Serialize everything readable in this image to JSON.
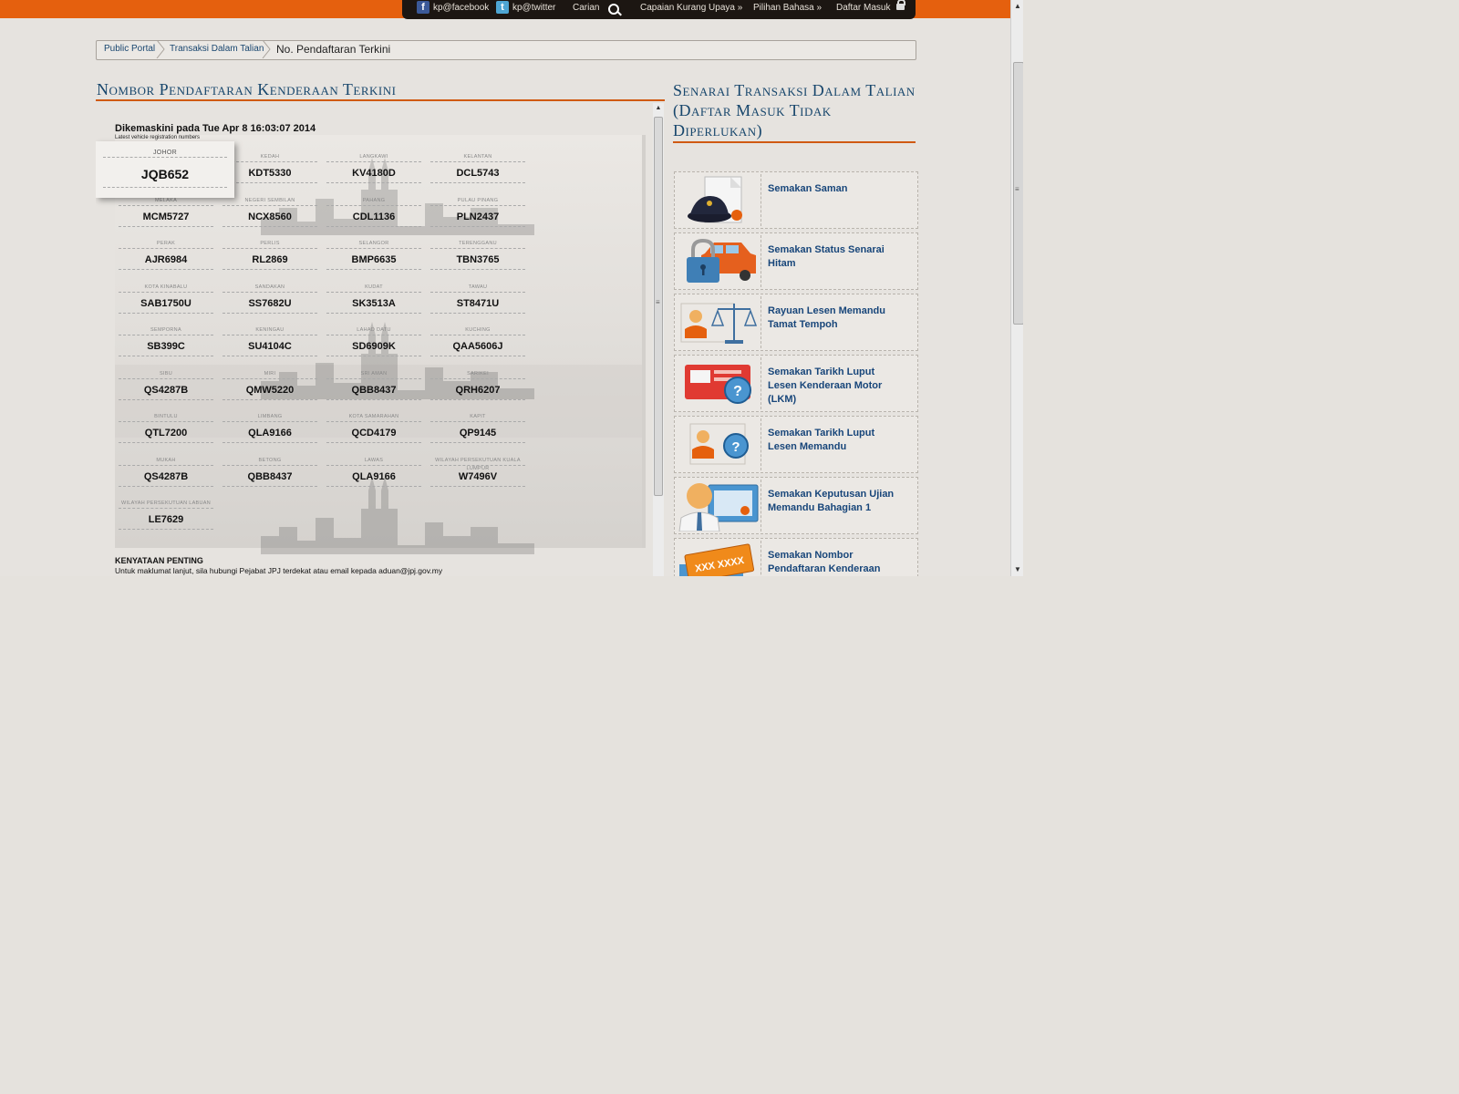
{
  "topnav": {
    "facebook": "kp@facebook",
    "twitter": "kp@twitter",
    "search": "Carian",
    "accessibility": "Capaian Kurang Upaya »",
    "language": "Pilihan Bahasa »",
    "login": "Daftar Masuk"
  },
  "breadcrumb": [
    "Public Portal",
    "Transaksi Dalam Talian",
    "No. Pendaftaran Terkini"
  ],
  "main": {
    "title": "Nombor Pendaftaran Kenderaan Terkini",
    "updated": "Dikemaskini pada Tue Apr 8 16:03:07 2014",
    "subtitle": "Latest vehicle registration numbers",
    "featured": {
      "state": "JOHOR",
      "number": "JQB652"
    },
    "plates": [
      {
        "state": "KEDAH",
        "number": "KDT5330"
      },
      {
        "state": "LANGKAWI",
        "number": "KV4180D"
      },
      {
        "state": "KELANTAN",
        "number": "DCL5743"
      },
      {
        "state": "MELAKA",
        "number": "MCM5727"
      },
      {
        "state": "NEGERI SEMBILAN",
        "number": "NCX8560"
      },
      {
        "state": "PAHANG",
        "number": "CDL1136"
      },
      {
        "state": "PULAU PINANG",
        "number": "PLN2437"
      },
      {
        "state": "PERAK",
        "number": "AJR6984"
      },
      {
        "state": "PERLIS",
        "number": "RL2869"
      },
      {
        "state": "SELANGOR",
        "number": "BMP6635"
      },
      {
        "state": "TERENGGANU",
        "number": "TBN3765"
      },
      {
        "state": "KOTA KINABALU",
        "number": "SAB1750U"
      },
      {
        "state": "SANDAKAN",
        "number": "SS7682U"
      },
      {
        "state": "KUDAT",
        "number": "SK3513A"
      },
      {
        "state": "TAWAU",
        "number": "ST8471U"
      },
      {
        "state": "SEMPORNA",
        "number": "SB399C"
      },
      {
        "state": "KENINGAU",
        "number": "SU4104C"
      },
      {
        "state": "LAHAD DATU",
        "number": "SD6909K"
      },
      {
        "state": "KUCHING",
        "number": "QAA5606J"
      },
      {
        "state": "SIBU",
        "number": "QS4287B"
      },
      {
        "state": "MIRI",
        "number": "QMW5220"
      },
      {
        "state": "SRI AMAN",
        "number": "QBB8437"
      },
      {
        "state": "SARIKEI",
        "number": "QRH6207"
      },
      {
        "state": "BINTULU",
        "number": "QTL7200"
      },
      {
        "state": "LIMBANG",
        "number": "QLA9166"
      },
      {
        "state": "KOTA SAMARAHAN",
        "number": "QCD4179"
      },
      {
        "state": "KAPIT",
        "number": "QP9145"
      },
      {
        "state": "MUKAH",
        "number": "QS4287B"
      },
      {
        "state": "BETONG",
        "number": "QBB8437"
      },
      {
        "state": "LAWAS",
        "number": "QLA9166"
      },
      {
        "state": "WILAYAH PERSEKUTUAN KUALA LUMPUR",
        "number": "W7496V"
      },
      {
        "state": "WILAYAH PERSEKUTUAN LABUAN",
        "number": "LE7629"
      }
    ],
    "notice_title": "KENYATAAN PENTING",
    "notice_text": "Untuk maklumat lanjut, sila hubungi Pejabat JPJ terdekat atau email kepada aduan@jpj.gov.my"
  },
  "sidebar": {
    "title": "Senarai Transaksi Dalam Talian (Daftar Masuk Tidak Diperlukan)",
    "items": [
      {
        "label": "Semakan Saman",
        "icon": "police-summons-icon"
      },
      {
        "label": "Semakan Status Senarai Hitam",
        "icon": "blacklist-car-lock-icon"
      },
      {
        "label": "Rayuan Lesen Memandu Tamat Tempoh",
        "icon": "license-appeal-scale-icon"
      },
      {
        "label": "Semakan Tarikh Luput Lesen Kenderaan Motor (LKM)",
        "icon": "road-tax-expiry-icon"
      },
      {
        "label": "Semakan Tarikh Luput Lesen Memandu",
        "icon": "driving-license-expiry-icon"
      },
      {
        "label": "Semakan Keputusan Ujian Memandu Bahagian 1",
        "icon": "driving-test-result-icon"
      },
      {
        "label": "Semakan Nombor Pendaftaran Kenderaan Terkini",
        "icon": "registration-plate-icon"
      }
    ]
  },
  "colors": {
    "accent": "#e5600e",
    "heading": "#17466c",
    "link": "#18467a",
    "background": "#e5e2dd"
  }
}
